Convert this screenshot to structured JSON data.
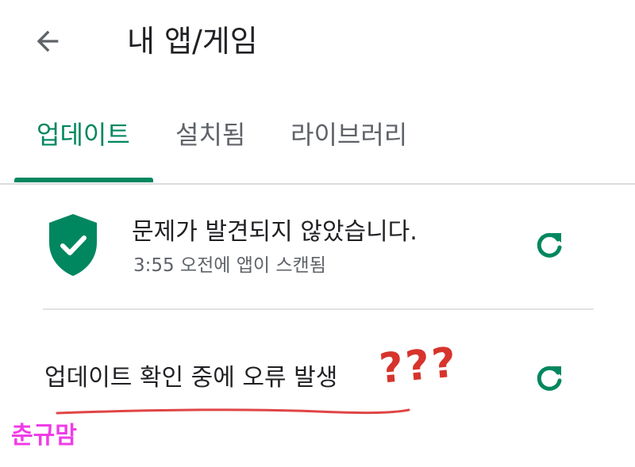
{
  "header": {
    "title": "내 앱/게임",
    "back_icon": "arrow-left-icon"
  },
  "tabs": [
    {
      "label": "업데이트",
      "active": true
    },
    {
      "label": "설치됨",
      "active": false
    },
    {
      "label": "라이브러리",
      "active": false
    }
  ],
  "scan_status": {
    "icon": "shield-check-icon",
    "title": "문제가 발견되지 않았습니다.",
    "subtitle": "3:55 오전에 앱이 스캔됨",
    "action_icon": "refresh-icon"
  },
  "update_check": {
    "message": "업데이트 확인 중에 오류 발생",
    "action_icon": "refresh-icon"
  },
  "annotations": {
    "question_marks": "???",
    "signature": "춘규맘"
  },
  "colors": {
    "accent": "#01875f",
    "text_primary": "#202124",
    "text_secondary": "#5f6368",
    "annotation_red": "#d6342c",
    "annotation_pink": "#f03ce6"
  }
}
